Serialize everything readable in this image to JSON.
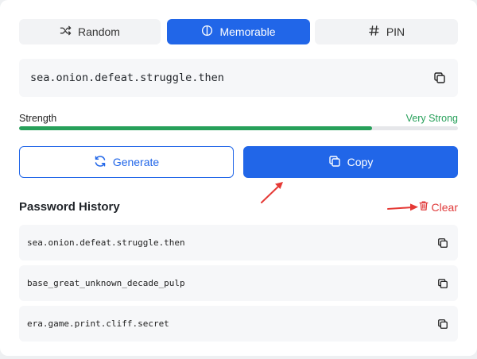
{
  "mode_tabs": [
    {
      "label": "Random",
      "icon": "shuffle-icon",
      "active": false
    },
    {
      "label": "Memorable",
      "icon": "circle-half-icon",
      "active": true
    },
    {
      "label": "PIN",
      "icon": "hash-icon",
      "active": false
    }
  ],
  "password": {
    "value": "sea.onion.defeat.struggle.then",
    "copy_icon": "copy-icon"
  },
  "strength": {
    "label": "Strength",
    "value_label": "Very Strong",
    "level": 0.804,
    "color": "#27a05a"
  },
  "actions": {
    "generate_label": "Generate",
    "copy_label": "Copy"
  },
  "history": {
    "title": "Password History",
    "clear_label": "Clear",
    "items": [
      "sea.onion.defeat.struggle.then",
      "base_great_unknown_decade_pulp",
      "era.game.print.cliff.secret"
    ]
  },
  "colors": {
    "accent": "#2166e8",
    "danger": "#e03b3b",
    "success": "#27a05a",
    "annotation": "#e53935"
  }
}
